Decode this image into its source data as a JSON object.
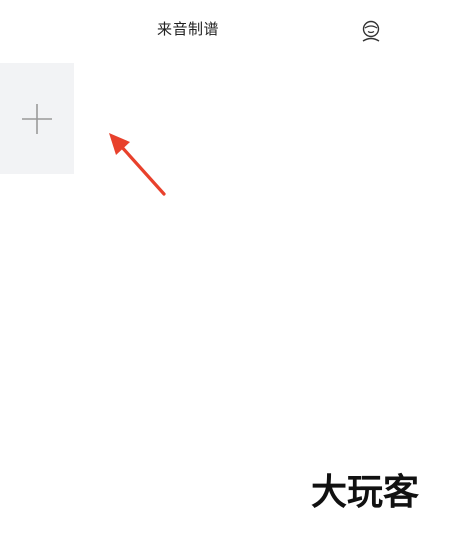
{
  "header": {
    "title": "来音制谱",
    "profile_icon": "user-profile-icon"
  },
  "add_tile": {
    "icon": "plus-icon"
  },
  "annotation": {
    "icon": "red-arrow-icon",
    "color": "#e8412c"
  },
  "watermark": {
    "text": "大玩客"
  },
  "colors": {
    "background": "#ffffff",
    "tile_background": "#f2f3f5",
    "plus_stroke": "#9a9a9a",
    "title_text": "#222222"
  }
}
